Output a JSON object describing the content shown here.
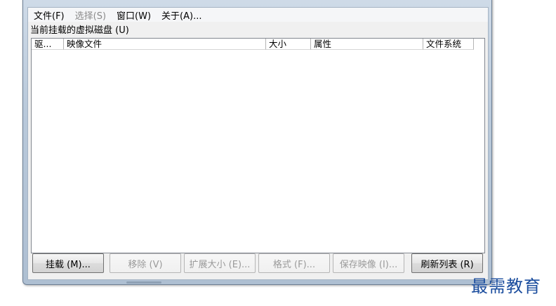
{
  "menubar": {
    "items": [
      {
        "label": "文件(F)",
        "enabled": true
      },
      {
        "label": "选择(S)",
        "enabled": false
      },
      {
        "label": "窗口(W)",
        "enabled": true
      },
      {
        "label": "关于(A)...",
        "enabled": true
      }
    ]
  },
  "section_label": "当前挂载的虚拟磁盘 (U)",
  "listview": {
    "columns": [
      "驱...",
      "映像文件",
      "大小",
      "属性",
      "文件系统"
    ],
    "rows": []
  },
  "buttons": {
    "mount": "挂载 (M)...",
    "remove": "移除 (V)",
    "extend": "扩展大小 (E)...",
    "format": "格式 (F)...",
    "save_image": "保存映像 (I)...",
    "refresh": "刷新列表 (R)"
  },
  "watermark": "最需教育"
}
